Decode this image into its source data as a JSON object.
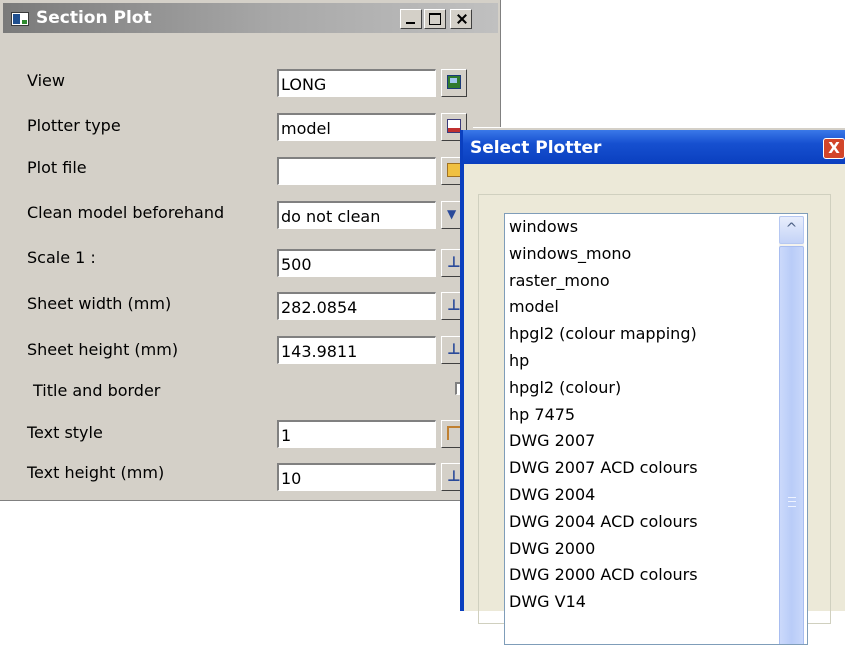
{
  "section_plot": {
    "title": "Section Plot",
    "controls": {
      "minimize_icon": "minimize-icon",
      "maximize_icon": "maximize-icon",
      "close_icon": "close-icon"
    },
    "fields": [
      {
        "label": "View",
        "value": "LONG",
        "icon": "view-picker-icon"
      },
      {
        "label": "Plotter type",
        "value": "model",
        "icon": "plotter-select-icon"
      },
      {
        "label": "Plot file",
        "value": "",
        "icon": "folder-icon"
      },
      {
        "label": "Clean model beforehand",
        "value": "do not clean",
        "icon": "dropdown-arrow-icon"
      },
      {
        "label": "Scale 1 :",
        "value": "500",
        "icon": "pick-value-icon"
      },
      {
        "label": "Sheet width (mm)",
        "value": "282.0854",
        "icon": "pick-value-icon"
      },
      {
        "label": "Sheet height (mm)",
        "value": "143.9811",
        "icon": "pick-value-icon"
      }
    ],
    "title_and_border": {
      "label": "Title and border",
      "checked": false
    },
    "text_fields": [
      {
        "label": "Text style",
        "value": "1",
        "icon": "text-style-icon"
      },
      {
        "label": "Text height (mm)",
        "value": "10",
        "icon": "pick-value-icon"
      }
    ]
  },
  "select_plotter": {
    "title": "Select Plotter",
    "close_label": "X",
    "items": [
      "windows",
      "windows_mono",
      "raster_mono",
      "model",
      "hpgl2 (colour mapping)",
      "hp",
      "hpgl2 (colour)",
      "hp 7475",
      "DWG 2007",
      "DWG 2007 ACD colours",
      "DWG 2004",
      "DWG 2004 ACD colours",
      "DWG 2000",
      "DWG 2000 ACD colours",
      "DWG V14"
    ],
    "scroll_up_glyph": "^"
  },
  "colors": {
    "dialog_face": "#d4d0c8",
    "xp_title_blue": "#0a3fbf",
    "xp_close_red": "#d2452a",
    "xp_face": "#ece9d8"
  }
}
